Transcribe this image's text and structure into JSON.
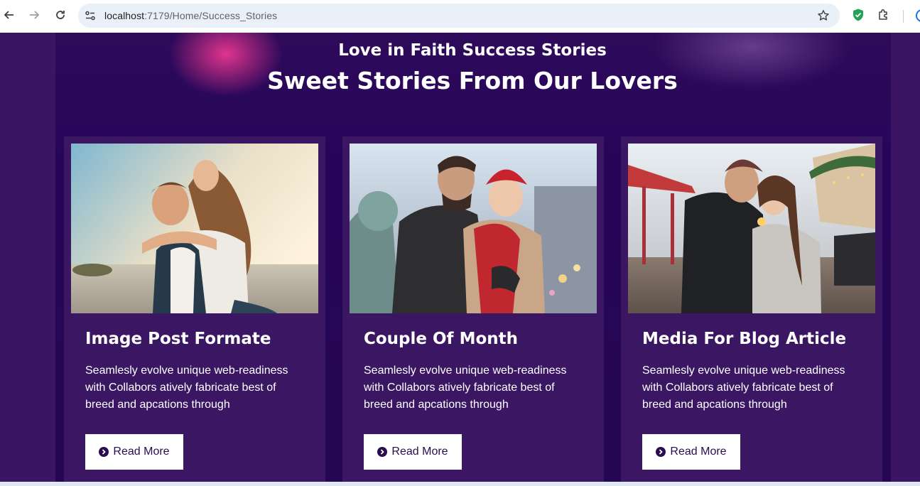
{
  "browser": {
    "url_host": "localhost",
    "url_path": ":7179/Home/Success_Stories"
  },
  "section": {
    "eyebrow": "Love in Faith Success Stories",
    "headline": "Sweet Stories From Our Lovers"
  },
  "cards": [
    {
      "title": "Image Post Formate",
      "text": "Seamlesly evolve unique web-readiness with Collabors atively fabricate best of breed and apcations through",
      "button": "Read More",
      "icon": "chevron-circle-right-icon"
    },
    {
      "title": "Couple Of Month",
      "text": "Seamlesly evolve unique web-readiness with Collabors atively fabricate best of breed and apcations through",
      "button": "Read More",
      "icon": "chevron-circle-right-icon"
    },
    {
      "title": "Media For Blog Article",
      "text": "Seamlesly evolve unique web-readiness with Collabors atively fabricate best of breed and apcations through",
      "button": "Read More",
      "icon": "chevron-circle-right-icon"
    }
  ],
  "colors": {
    "page_bg": "#3b1464",
    "card_bg": "#3a1663",
    "button_text": "#2b0c4f",
    "accent_glow": "#ff3c96"
  }
}
